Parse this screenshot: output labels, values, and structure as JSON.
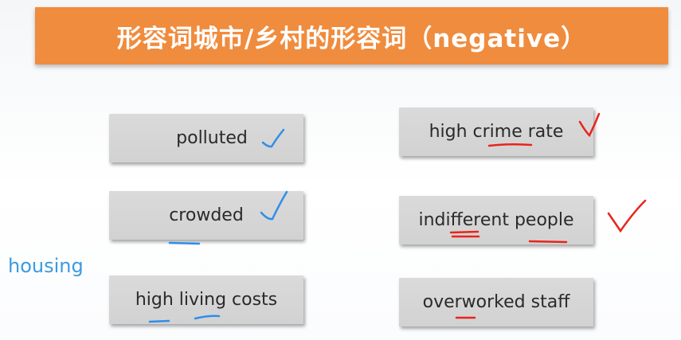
{
  "slide": {
    "title": "形容词城市/乡村的形容词（negative）",
    "side_note": "housing",
    "left_cards": [
      {
        "label": "polluted"
      },
      {
        "label": "crowded"
      },
      {
        "label": "high living costs"
      }
    ],
    "right_cards": [
      {
        "label": "high crime rate"
      },
      {
        "label": "indifferent people"
      },
      {
        "label": "overworked staff"
      }
    ]
  },
  "colors": {
    "title_bar": "#f08c3e",
    "card": "#d6d6d6",
    "blue_ink": "#2f8ee8",
    "red_ink": "#e8241c",
    "note_text": "#3a9be0"
  }
}
